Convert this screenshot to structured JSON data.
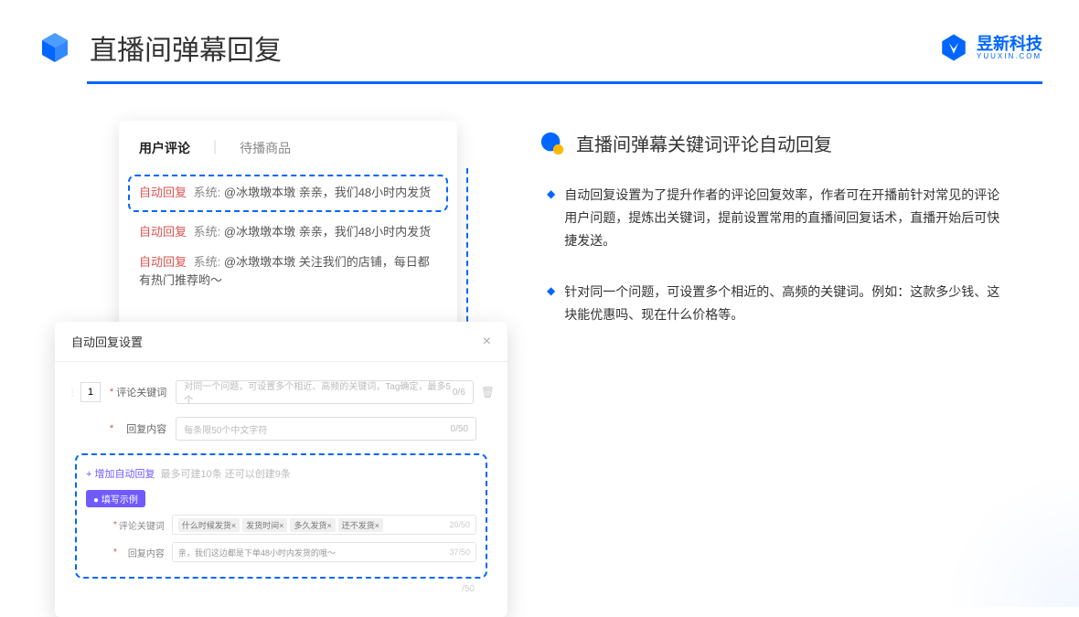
{
  "header": {
    "title": "直播间弹幕回复",
    "brand": "昱新科技",
    "brand_sub": "YUUXIN.COM"
  },
  "comment_card": {
    "tab_active": "用户评论",
    "tab_inactive": "待播商品",
    "rows": [
      {
        "badge": "自动回复",
        "sys": "系统:",
        "text": "@冰墩墩本墩 亲亲，我们48小时内发货"
      },
      {
        "badge": "自动回复",
        "sys": "系统:",
        "text": "@冰墩墩本墩 亲亲，我们48小时内发货"
      },
      {
        "badge": "自动回复",
        "sys": "系统:",
        "text": "@冰墩墩本墩 关注我们的店铺，每日都有热门推荐哟～"
      }
    ]
  },
  "settings": {
    "title": "自动回复设置",
    "num": "1",
    "row1_label": "评论关键词",
    "row1_placeholder": "对同一个问题，可设置多个相近、高频的关键词，Tag确定，最多5个",
    "row1_counter": "0/6",
    "row2_label": "回复内容",
    "row2_placeholder": "每条限50个中文字符",
    "row2_counter": "0/50",
    "add_link": "+ 增加自动回复",
    "add_hint": "最多可建10条 还可以创建9条",
    "example_badge": "● 填写示例",
    "ex1_label": "评论关键词",
    "ex1_tags": [
      "什么时候发货×",
      "发货时间×",
      "多久发货×",
      "还不发货×"
    ],
    "ex1_counter": "20/50",
    "ex2_label": "回复内容",
    "ex2_text": "亲，我们这边都是下单48小时内发货的哦～",
    "ex2_counter": "37/50",
    "bottom_counter": "/50"
  },
  "right": {
    "section_title": "直播间弹幕关键词评论自动回复",
    "bullets": [
      "自动回复设置为了提升作者的评论回复效率，作者可在开播前针对常见的评论用户问题，提炼出关键词，提前设置常用的直播间回复话术，直播开始后可快捷发送。",
      "针对同一个问题，可设置多个相近的、高频的关键词。例如：这款多少钱、这块能优惠吗、现在什么价格等。"
    ]
  }
}
